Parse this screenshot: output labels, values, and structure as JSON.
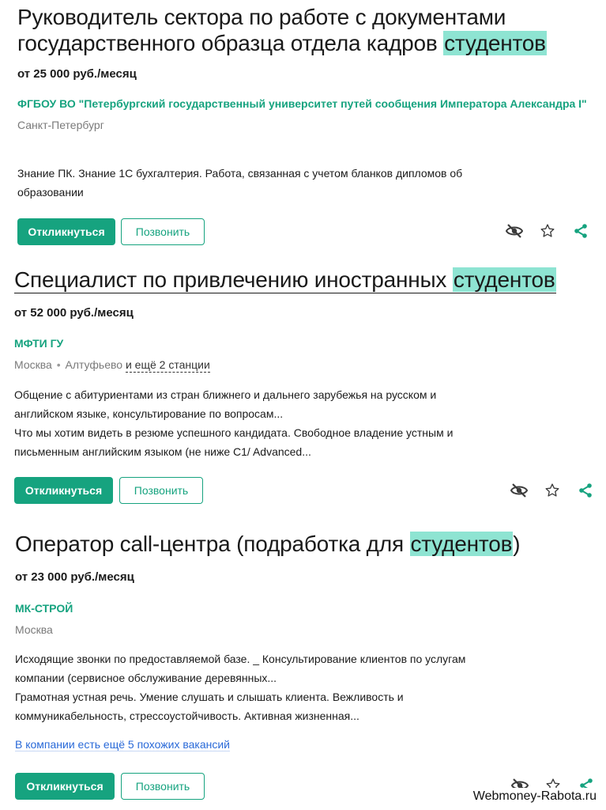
{
  "colors": {
    "accent": "#16a37f",
    "highlight": "#8ee4d2",
    "link_blue": "#2a6ad8",
    "muted": "#7a7a7a"
  },
  "icons": [
    "eye-slash-icon",
    "star-icon",
    "share-icon"
  ],
  "vacancies": [
    {
      "title_line1": "Руководитель сектора по работе с документами",
      "title_line2_before": "государственного образца отдела кадров ",
      "title_highlight": "студентов",
      "salary": "от 25 000 руб./месяц",
      "company": "ФГБОУ ВО \"Петербургский государственный университет путей сообщения Императора Александра I\"",
      "city": "Санкт-Петербург",
      "description": [
        "Знание ПК. Знание 1С бухгалтерия. Работа, связанная с учетом бланков дипломов об",
        "образовании"
      ],
      "respond_label": "Откликнуться",
      "call_label": "Позвонить"
    },
    {
      "title_before": "Специалист по привлечению иностранных ",
      "title_highlight": "студентов",
      "salary": "от 52 000 руб./месяц",
      "company": "МФТИ ГУ",
      "city": "Москва",
      "metro": "Алтуфьево",
      "metro_more": "и ещё 2 станции",
      "description": [
        "Общение с абитуриентами из стран ближнего и дальнего зарубежья на русском и",
        "английском языке, консультирование по вопросам...",
        "Что мы хотим видеть в резюме успешного кандидата. Свободное владение устным и",
        "письменным английским языком (не ниже C1/ Advanced..."
      ],
      "respond_label": "Откликнуться",
      "call_label": "Позвонить"
    },
    {
      "title_before": "Оператор call-центра (подработка для ",
      "title_highlight": "студентов",
      "title_after": ")",
      "salary": "от 23 000 руб./месяц",
      "company": "МК-СТРОЙ",
      "city": "Москва",
      "description": [
        "Исходящие звонки по предоставляемой базе. _ Консультирование клиентов по услугам",
        "компании (сервисное обслуживание деревянных...",
        "Грамотная устная речь. Умение слушать и слышать клиента. Вежливость и",
        "коммуникабельность, стрессоустойчивость. Активная жизненная..."
      ],
      "similar_link": "В компании есть ещё 5 похожих вакансий",
      "respond_label": "Откликнуться",
      "call_label": "Позвонить"
    }
  ],
  "watermark": "Webmoney-Rabota.ru"
}
